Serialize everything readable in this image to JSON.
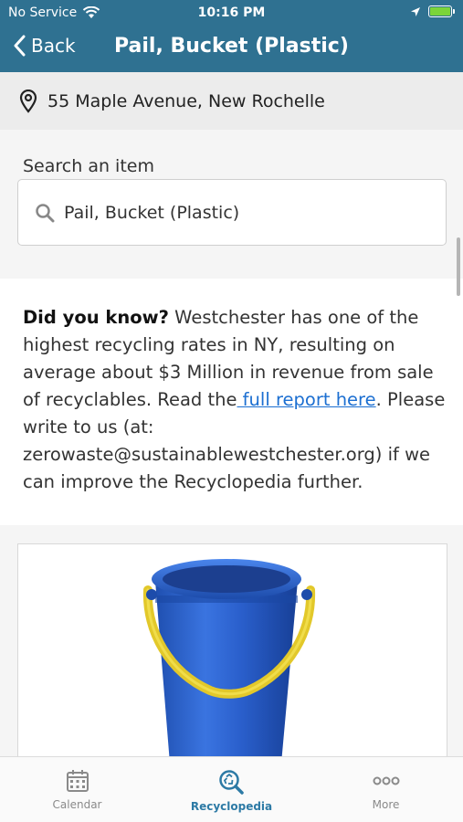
{
  "status_bar": {
    "carrier": "No Service",
    "time": "10:16 PM"
  },
  "nav": {
    "back_label": "Back",
    "title": "Pail, Bucket (Plastic)"
  },
  "address": {
    "text": "55 Maple Avenue, New Rochelle"
  },
  "search": {
    "label": "Search an item",
    "value": "Pail, Bucket (Plastic)"
  },
  "info": {
    "heading": "Did you know?",
    "text_1": " Westchester has one of the highest recycling rates in NY,  resulting on average about $3 Million in revenue from sale of recyclables. Read the",
    "link": " full report here",
    "text_2": ". Please write to us (at: zerowaste@sustainablewestchester.org) if we can improve the Recyclopedia further."
  },
  "tabs": [
    {
      "label": "Calendar",
      "icon": "calendar-icon"
    },
    {
      "label": "Recyclopedia",
      "icon": "recyclopedia-icon",
      "active": true
    },
    {
      "label": "More",
      "icon": "more-icon"
    }
  ],
  "colors": {
    "header": "#2f7191",
    "active_tab": "#2d7aa5",
    "link": "#1c6fd1"
  }
}
